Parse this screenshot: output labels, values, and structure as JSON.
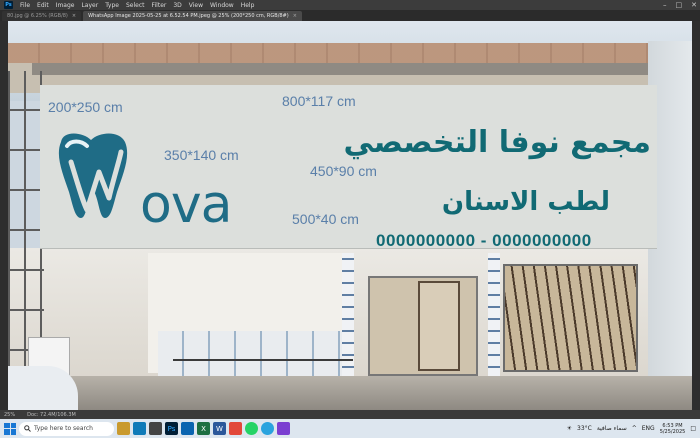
{
  "menubar": {
    "app_badge": "Ps",
    "items": [
      "File",
      "Edit",
      "Image",
      "Layer",
      "Type",
      "Select",
      "Filter",
      "3D",
      "View",
      "Window",
      "Help"
    ]
  },
  "tabs": [
    {
      "label": "80.jpg @ 6.25% (RGB/8)"
    },
    {
      "label": "WhatsApp Image 2025-05-25 at 6.52.54 PM.jpeg @ 25% (200*250 cm, RGB/8#)"
    }
  ],
  "sign": {
    "dims": {
      "logo": "200*250 cm",
      "title": "800*117 cm",
      "brand": "350*140 cm",
      "subtitle": "450*90 cm",
      "phones": "500*40 cm"
    },
    "brand_text": "ova",
    "title_ar": "مجمع نوفا التخصصي",
    "subtitle_ar": "لطب الاسنان",
    "phones": "0000000000 - 0000000000",
    "colors": {
      "teal": "#116a74",
      "logo_blue": "#1f6c86",
      "dim_blue": "#5a7fa9"
    }
  },
  "statusbar": {
    "zoom": "25%",
    "doc": "Doc: 72.4M/106.3M"
  },
  "taskbar": {
    "search_placeholder": "Type here to search",
    "apps": [
      "file-explorer",
      "edge",
      "ms-store",
      "photoshop",
      "mail",
      "excel",
      "word",
      "chrome",
      "whatsapp",
      "telegram",
      "snipping"
    ],
    "weather": "33°C",
    "weather_desc": "سماء صافية",
    "time": "6:53 PM",
    "date": "5/25/2025",
    "lang": "ENG"
  }
}
